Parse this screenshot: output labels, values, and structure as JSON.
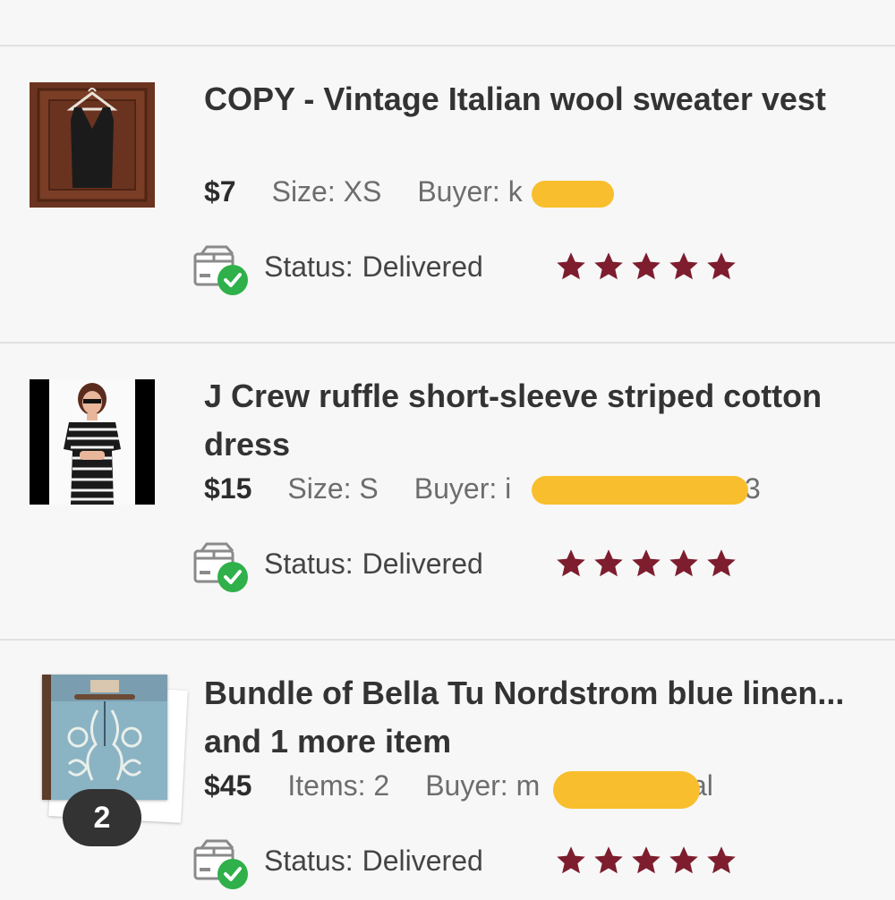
{
  "orders": [
    {
      "title": "COPY - Vintage Italian wool sweater vest",
      "price": "$7",
      "detail": "Size: XS",
      "buyer_label": "Buyer:",
      "buyer_visible": "k",
      "status_label": "Status:",
      "status_value": "Delivered",
      "rating": 5
    },
    {
      "title": "J Crew ruffle short-sleeve striped cotton dress",
      "price": "$15",
      "detail": "Size: S",
      "buyer_label": "Buyer:",
      "buyer_visible": "i",
      "buyer_visible_end": "3",
      "status_label": "Status:",
      "status_value": "Delivered",
      "rating": 5
    },
    {
      "title": "Bundle of Bella Tu Nordstrom blue linen... and 1 more item",
      "price": "$45",
      "detail": "Items: 2",
      "buyer_label": "Buyer:",
      "buyer_visible": "m",
      "buyer_visible_end": "al",
      "bundle_count": "2",
      "status_label": "Status:",
      "status_value": "Delivered",
      "rating": 5
    }
  ],
  "colors": {
    "star": "#7d1d2e",
    "check": "#2fb04a",
    "redaction": "#f8be2d",
    "divider": "#e1e1e1"
  },
  "icons": {
    "status": "package-delivered-icon",
    "rating": "star-icon"
  }
}
